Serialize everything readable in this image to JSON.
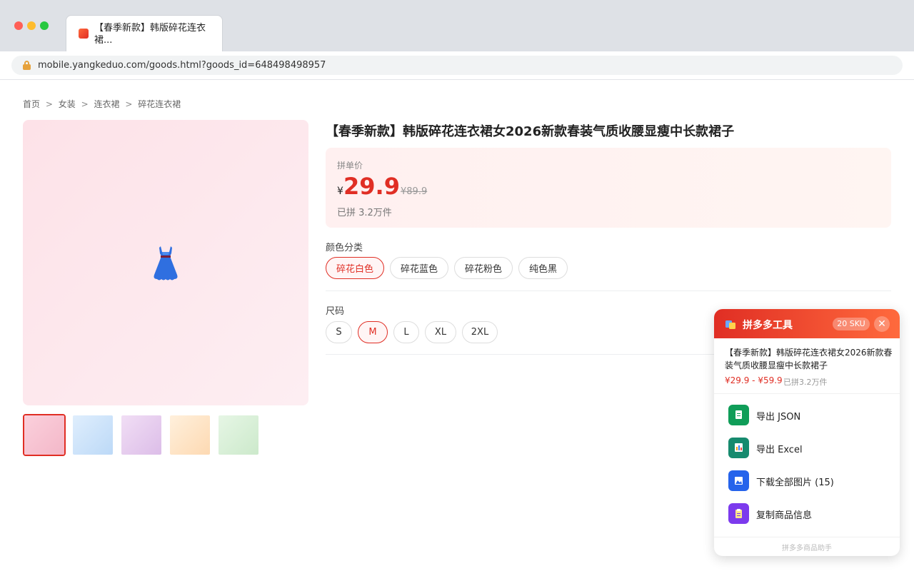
{
  "browser": {
    "tab_title": "【春季新款】韩版碎花连衣裙...",
    "url": "mobile.yangkeduo.com/goods.html?goods_id=648498498957"
  },
  "breadcrumb": [
    "首页",
    "女装",
    "连衣裙",
    "碎花连衣裙"
  ],
  "breadcrumb_sep": ">",
  "product": {
    "title": "【春季新款】韩版碎花连衣裙女2026新款春装气质收腰显瘦中长款裙子",
    "price_label": "拼单价",
    "currency": "¥",
    "price": "29.9",
    "original_price": "¥89.9",
    "sold": "已拼 3.2万件",
    "image_icon": "dress-icon",
    "thumbnails": [
      {
        "color": "#f7c6d3",
        "selected": true
      },
      {
        "color": "#cfe4fb",
        "selected": false
      },
      {
        "color": "#e6cdef",
        "selected": false
      },
      {
        "color": "#fde3c4",
        "selected": false
      },
      {
        "color": "#d6efd5",
        "selected": false
      }
    ]
  },
  "color_section": {
    "label": "颜色分类",
    "options": [
      "碎花白色",
      "碎花蓝色",
      "碎花粉色",
      "纯色黑"
    ],
    "selected": "碎花白色"
  },
  "size_section": {
    "label": "尺码",
    "options": [
      "S",
      "M",
      "L",
      "XL",
      "2XL"
    ],
    "selected": "M"
  },
  "extension": {
    "title": "拼多多工具",
    "badge": "20 SKU",
    "product_title": "【春季新款】韩版碎花连衣裙女2026新款春装气质收腰显瘦中长款裙子",
    "price_range": "¥29.9 - ¥59.9",
    "sold": "已拼3.2万件",
    "actions": [
      {
        "label": "导出 JSON",
        "icon": "document-icon",
        "color": "#0f9d58"
      },
      {
        "label": "导出 Excel",
        "icon": "spreadsheet-icon",
        "color": "#168a6e"
      },
      {
        "label": "下载全部图片 (15)",
        "icon": "image-icon",
        "color": "#2563eb"
      },
      {
        "label": "复制商品信息",
        "icon": "clipboard-icon",
        "color": "#7c3aed"
      }
    ],
    "footer": "拼多多商品助手",
    "accent": "#e02e24"
  }
}
